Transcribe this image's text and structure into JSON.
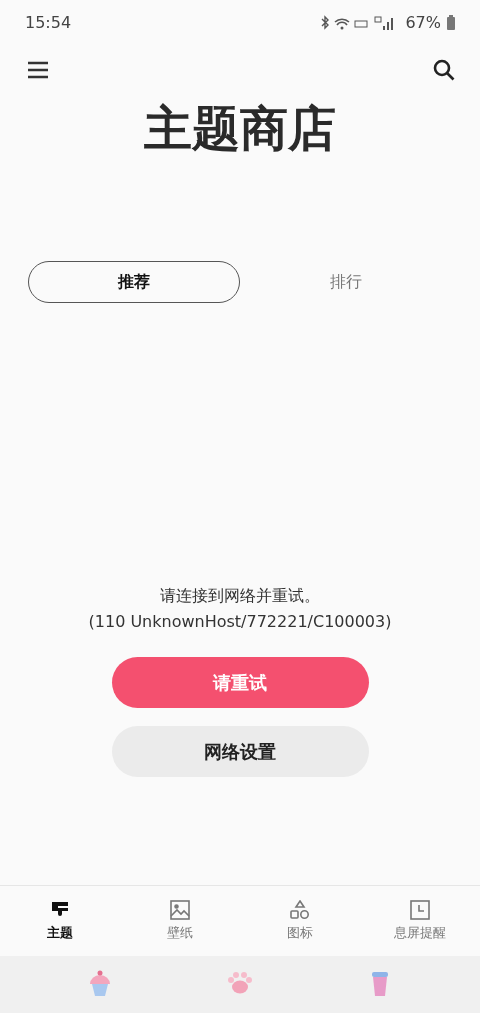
{
  "status_bar": {
    "time": "15:54",
    "battery": "67%"
  },
  "header": {
    "title": "主题商店"
  },
  "tabs": [
    {
      "label": "推荐",
      "selected": true
    },
    {
      "label": "排行",
      "selected": false
    }
  ],
  "error": {
    "message": "请连接到网络并重试。",
    "code": "(110 UnknownHost/772221/C100003)"
  },
  "buttons": [
    {
      "label": "请重试",
      "kind": "primary"
    },
    {
      "label": "网络设置",
      "kind": "secondary"
    }
  ],
  "bottom_nav": [
    {
      "label": "主题",
      "selected": true
    },
    {
      "label": "壁纸",
      "selected": false
    },
    {
      "label": "图标",
      "selected": false
    },
    {
      "label": "息屏提醒",
      "selected": false
    }
  ]
}
